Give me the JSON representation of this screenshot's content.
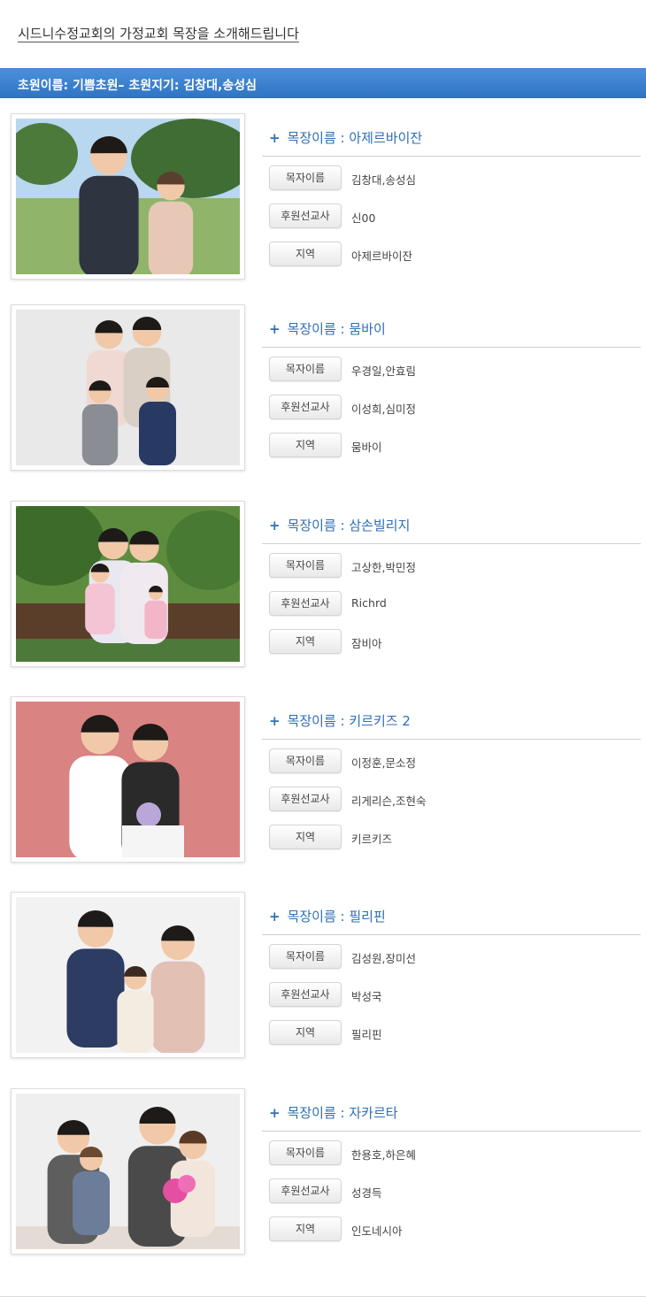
{
  "intro": "시드니수정교회의 가정교회 목장을 소개해드립니다",
  "banner": "초원이름: 기쁨초원– 초원지기: 김창대,송성심",
  "labels": {
    "pastor": "목자이름",
    "missionary": "후원선교사",
    "region": "지역"
  },
  "title_prefix": "목장이름 : ",
  "cards": [
    {
      "name": "아제르바이잔",
      "pastor": "김창대,송성심",
      "missionary": "신00",
      "region": "아제르바이잔",
      "scene": "park",
      "bg": "#8fb46a",
      "sky": "#b9d7ee"
    },
    {
      "name": "뭄바이",
      "pastor": "우경일,안효림",
      "missionary": "이성희,심미정",
      "region": "뭄바이",
      "scene": "studio-4",
      "bg": "#e9e9e9"
    },
    {
      "name": "삼손빌리지",
      "pastor": "고상한,박민정",
      "missionary": "Richrd",
      "region": "잠비아",
      "scene": "garden",
      "bg": "#5d8c3e"
    },
    {
      "name": "키르키즈 2",
      "pastor": "이정훈,문소정",
      "missionary": "리게리슨,조현숙",
      "region": "키르키즈",
      "scene": "wedding",
      "bg": "#d98383"
    },
    {
      "name": "필리핀",
      "pastor": "김성원,장미선",
      "missionary": "박성국",
      "region": "필리핀",
      "scene": "studio-3",
      "bg": "#f2f2f2"
    },
    {
      "name": "자카르타",
      "pastor": "한용호,하은혜",
      "missionary": "성경득",
      "region": "인도네시아",
      "scene": "studio-flowers",
      "bg": "#efefef"
    }
  ]
}
